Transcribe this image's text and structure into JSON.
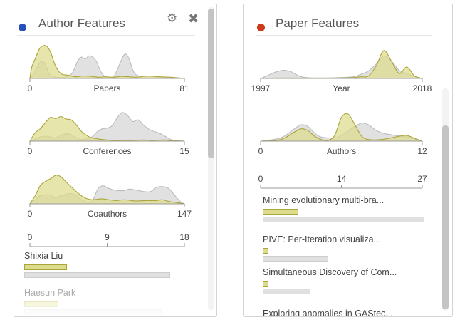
{
  "author_panel": {
    "title": "Author Features",
    "dot_color": "#2a4fb8",
    "settings_icon": "gear-icon",
    "close_icon": "close-icon",
    "charts": [
      {
        "type": "area",
        "xlabel": "Papers",
        "xmin_label": "0",
        "xmax_label": "81",
        "total": [
          [
            0,
            0
          ],
          [
            2,
            12
          ],
          [
            4,
            30
          ],
          [
            6,
            42
          ],
          [
            8,
            35
          ],
          [
            10,
            12
          ],
          [
            12,
            5
          ],
          [
            14,
            3
          ],
          [
            18,
            3
          ],
          [
            22,
            12
          ],
          [
            25,
            42
          ],
          [
            27,
            52
          ],
          [
            29,
            48
          ],
          [
            31,
            55
          ],
          [
            33,
            52
          ],
          [
            35,
            40
          ],
          [
            37,
            18
          ],
          [
            39,
            6
          ],
          [
            41,
            2
          ],
          [
            44,
            5
          ],
          [
            48,
            45
          ],
          [
            50,
            60
          ],
          [
            52,
            48
          ],
          [
            54,
            20
          ],
          [
            56,
            8
          ],
          [
            60,
            5
          ],
          [
            65,
            4
          ],
          [
            70,
            3
          ],
          [
            75,
            2
          ],
          [
            81,
            0
          ]
        ],
        "selected": [
          [
            0,
            0
          ],
          [
            1,
            28
          ],
          [
            3,
            50
          ],
          [
            5,
            72
          ],
          [
            7,
            80
          ],
          [
            9,
            78
          ],
          [
            11,
            62
          ],
          [
            13,
            35
          ],
          [
            15,
            18
          ],
          [
            17,
            10
          ],
          [
            20,
            8
          ],
          [
            24,
            4
          ],
          [
            28,
            6
          ],
          [
            32,
            5
          ],
          [
            36,
            3
          ],
          [
            40,
            4
          ],
          [
            44,
            3
          ],
          [
            48,
            5
          ],
          [
            52,
            4
          ],
          [
            56,
            3
          ],
          [
            62,
            6
          ],
          [
            68,
            4
          ],
          [
            74,
            3
          ],
          [
            81,
            0
          ]
        ]
      },
      {
        "type": "area",
        "xlabel": "Conferences",
        "xmin_label": "0",
        "xmax_label": "15",
        "total": [
          [
            0,
            0
          ],
          [
            0.5,
            5
          ],
          [
            1,
            10
          ],
          [
            1.5,
            12
          ],
          [
            2,
            10
          ],
          [
            2.5,
            8
          ],
          [
            3,
            14
          ],
          [
            3.5,
            18
          ],
          [
            4,
            16
          ],
          [
            4.5,
            8
          ],
          [
            5,
            4
          ],
          [
            5.5,
            6
          ],
          [
            6,
            10
          ],
          [
            6.5,
            22
          ],
          [
            7,
            30
          ],
          [
            7.5,
            32
          ],
          [
            8,
            38
          ],
          [
            8.5,
            58
          ],
          [
            9,
            70
          ],
          [
            9.5,
            62
          ],
          [
            10,
            48
          ],
          [
            10.5,
            52
          ],
          [
            11,
            40
          ],
          [
            11.5,
            30
          ],
          [
            12,
            24
          ],
          [
            12.5,
            20
          ],
          [
            13,
            14
          ],
          [
            13.5,
            6
          ],
          [
            14,
            2
          ],
          [
            15,
            0
          ]
        ],
        "selected": [
          [
            0,
            0
          ],
          [
            0.5,
            20
          ],
          [
            1,
            30
          ],
          [
            1.5,
            45
          ],
          [
            2,
            58
          ],
          [
            2.5,
            55
          ],
          [
            3,
            60
          ],
          [
            3.5,
            54
          ],
          [
            4,
            52
          ],
          [
            4.5,
            40
          ],
          [
            5,
            24
          ],
          [
            5.5,
            14
          ],
          [
            6,
            8
          ],
          [
            6.5,
            6
          ],
          [
            7,
            4
          ],
          [
            8,
            2
          ],
          [
            9,
            2
          ],
          [
            10,
            2
          ],
          [
            11,
            3
          ],
          [
            12,
            2
          ],
          [
            13,
            3
          ],
          [
            14,
            1
          ],
          [
            15,
            0
          ]
        ]
      },
      {
        "type": "area",
        "xlabel": "Coauthors",
        "xmin_label": "0",
        "xmax_label": "147",
        "total": [
          [
            0,
            0
          ],
          [
            5,
            10
          ],
          [
            10,
            20
          ],
          [
            18,
            22
          ],
          [
            24,
            15
          ],
          [
            30,
            20
          ],
          [
            40,
            25
          ],
          [
            48,
            12
          ],
          [
            55,
            4
          ],
          [
            60,
            10
          ],
          [
            65,
            38
          ],
          [
            70,
            44
          ],
          [
            75,
            38
          ],
          [
            80,
            34
          ],
          [
            88,
            32
          ],
          [
            95,
            36
          ],
          [
            100,
            34
          ],
          [
            108,
            30
          ],
          [
            115,
            30
          ],
          [
            120,
            40
          ],
          [
            126,
            42
          ],
          [
            132,
            38
          ],
          [
            138,
            20
          ],
          [
            143,
            6
          ],
          [
            147,
            0
          ]
        ],
        "selected": [
          [
            0,
            0
          ],
          [
            5,
            20
          ],
          [
            10,
            45
          ],
          [
            15,
            55
          ],
          [
            20,
            62
          ],
          [
            25,
            70
          ],
          [
            30,
            65
          ],
          [
            35,
            52
          ],
          [
            40,
            40
          ],
          [
            45,
            28
          ],
          [
            50,
            18
          ],
          [
            55,
            12
          ],
          [
            60,
            10
          ],
          [
            68,
            12
          ],
          [
            75,
            10
          ],
          [
            82,
            8
          ],
          [
            90,
            10
          ],
          [
            100,
            7
          ],
          [
            110,
            8
          ],
          [
            120,
            8
          ],
          [
            126,
            10
          ],
          [
            132,
            6
          ],
          [
            140,
            3
          ],
          [
            147,
            0
          ]
        ]
      }
    ],
    "list_axis": {
      "min": "0",
      "mid": "9",
      "max": "18",
      "max_value": 18
    },
    "items": [
      {
        "label": "Shixia Liu",
        "selected": 5,
        "total": 17,
        "faded": false
      },
      {
        "label": "Haesun Park",
        "selected": 4,
        "total": 16,
        "faded": true
      }
    ]
  },
  "paper_panel": {
    "title": "Paper Features",
    "dot_color": "#cc3a1a",
    "charts": [
      {
        "type": "area",
        "xlabel": "Year",
        "xmin_label": "1997",
        "xmax_label": "2018",
        "xmin": 1997,
        "xmax": 2018,
        "total": [
          [
            1997,
            0
          ],
          [
            1998,
            8
          ],
          [
            1999,
            16
          ],
          [
            2000,
            20
          ],
          [
            2001,
            16
          ],
          [
            2002,
            6
          ],
          [
            2003,
            2
          ],
          [
            2005,
            1
          ],
          [
            2007,
            2
          ],
          [
            2009,
            4
          ],
          [
            2010,
            10
          ],
          [
            2011,
            18
          ],
          [
            2012,
            35
          ],
          [
            2013,
            55
          ],
          [
            2014,
            42
          ],
          [
            2015,
            20
          ],
          [
            2016,
            12
          ],
          [
            2017,
            5
          ],
          [
            2018,
            0
          ]
        ],
        "selected": [
          [
            1997,
            0
          ],
          [
            1999,
            1
          ],
          [
            2001,
            1
          ],
          [
            2003,
            1
          ],
          [
            2005,
            1
          ],
          [
            2007,
            1
          ],
          [
            2009,
            2
          ],
          [
            2010,
            4
          ],
          [
            2011,
            6
          ],
          [
            2012,
            30
          ],
          [
            2013,
            68
          ],
          [
            2014,
            42
          ],
          [
            2015,
            12
          ],
          [
            2016,
            28
          ],
          [
            2017,
            6
          ],
          [
            2018,
            0
          ]
        ]
      },
      {
        "type": "area",
        "xlabel": "Authors",
        "xmin_label": "0",
        "xmax_label": "12",
        "total": [
          [
            0,
            0
          ],
          [
            1.5,
            8
          ],
          [
            2.5,
            30
          ],
          [
            3,
            40
          ],
          [
            3.5,
            36
          ],
          [
            4,
            20
          ],
          [
            4.5,
            10
          ],
          [
            5.5,
            8
          ],
          [
            6,
            14
          ],
          [
            7,
            36
          ],
          [
            7.5,
            44
          ],
          [
            8,
            40
          ],
          [
            8.5,
            28
          ],
          [
            9,
            20
          ],
          [
            10,
            14
          ],
          [
            11,
            10
          ],
          [
            11.5,
            4
          ],
          [
            12,
            0
          ]
        ],
        "selected": [
          [
            0,
            0
          ],
          [
            1.5,
            4
          ],
          [
            2.5,
            22
          ],
          [
            3,
            30
          ],
          [
            3.5,
            26
          ],
          [
            4,
            12
          ],
          [
            4.5,
            4
          ],
          [
            5,
            2
          ],
          [
            5.5,
            14
          ],
          [
            6,
            58
          ],
          [
            6.5,
            66
          ],
          [
            7,
            40
          ],
          [
            7.5,
            12
          ],
          [
            8,
            4
          ],
          [
            9,
            4
          ],
          [
            10,
            10
          ],
          [
            10.8,
            14
          ],
          [
            11.5,
            6
          ],
          [
            12,
            0
          ]
        ]
      }
    ],
    "list_axis": {
      "min": "0",
      "mid": "14",
      "max": "27",
      "max_value": 27
    },
    "items": [
      {
        "label": "Mining evolutionary multi-bra...",
        "selected": 6,
        "total": 27,
        "faded": false
      },
      {
        "label": "PIVE: Per-Iteration visualiza...",
        "selected": 1,
        "total": 11,
        "faded": false
      },
      {
        "label": "Simultaneous Discovery of Com...",
        "selected": 1,
        "total": 8,
        "faded": false
      },
      {
        "label": "Exploring anomalies in GAStec...",
        "selected": 0,
        "total": 0,
        "faded": false
      }
    ]
  }
}
